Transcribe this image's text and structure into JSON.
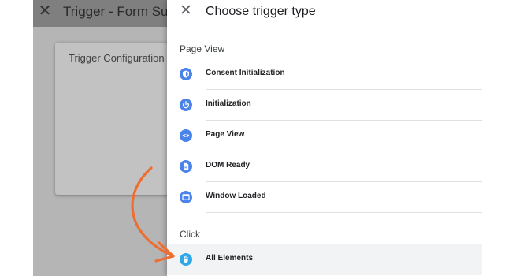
{
  "background": {
    "header_title": "Trigger - Form Submi",
    "card_title": "Trigger Configuration"
  },
  "panel": {
    "title": "Choose trigger type",
    "sections": [
      {
        "label": "Page View",
        "items": [
          {
            "label": "Consent Initialization",
            "icon": "shield-icon"
          },
          {
            "label": "Initialization",
            "icon": "power-icon"
          },
          {
            "label": "Page View",
            "icon": "eye-icon"
          },
          {
            "label": "DOM Ready",
            "icon": "document-icon"
          },
          {
            "label": "Window Loaded",
            "icon": "window-icon"
          }
        ]
      },
      {
        "label": "Click",
        "items": [
          {
            "label": "All Elements",
            "icon": "mouse-icon"
          }
        ]
      }
    ]
  },
  "colors": {
    "icon_blue": "#4a83ea",
    "icon_highlight": "#2fa8e8",
    "arrow": "#ee6d31",
    "overlay_gray": "#b5b5b5"
  }
}
